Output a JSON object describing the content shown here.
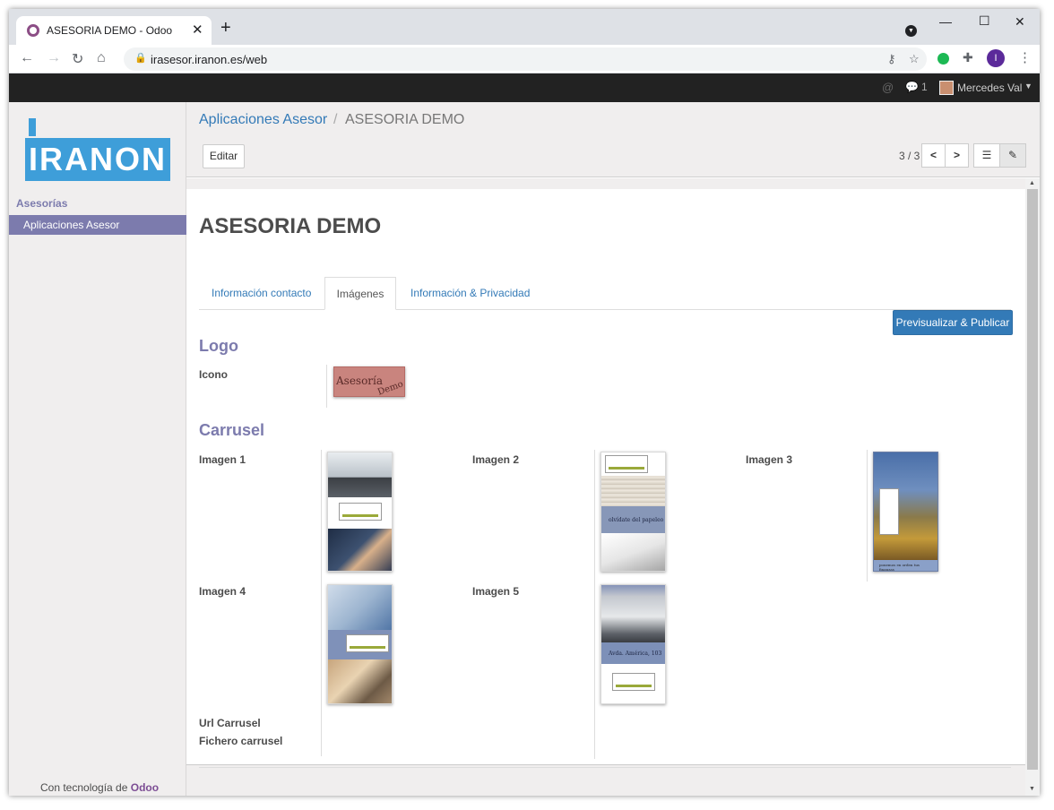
{
  "browser": {
    "tab_title": "ASESORIA DEMO - Odoo",
    "tab_close": "✕",
    "new_tab": "+",
    "url": "irasesor.iranon.es/web",
    "window_minimize": "—",
    "window_maximize": "☐",
    "window_close": "✕",
    "profile_initial": "I"
  },
  "topbar": {
    "chat_count": "1",
    "user_name": "Mercedes Val"
  },
  "sidebar": {
    "logo_text": "IRANON",
    "section_title": "Asesorías",
    "items": [
      {
        "label": "Aplicaciones Asesor"
      }
    ],
    "powered_prefix": "Con tecnología de ",
    "powered_brand": "Odoo"
  },
  "control_panel": {
    "breadcrumb_link": "Aplicaciones Asesor",
    "breadcrumb_sep": "/",
    "breadcrumb_current": "ASESORIA DEMO",
    "edit_label": "Editar",
    "pager": "3 / 3",
    "prev": "<",
    "next": ">"
  },
  "form": {
    "title": "ASESORIA DEMO",
    "tabs": [
      {
        "label": "Información contacto"
      },
      {
        "label": "Imágenes"
      },
      {
        "label": "Información & Privacidad"
      }
    ],
    "active_tab": 1,
    "publish_label": "Previsualizar & Publicar",
    "logo_section": "Logo",
    "icon_label": "Icono",
    "icon_image_text": [
      "Asesoría",
      "Demo"
    ],
    "carrusel_section": "Carrusel",
    "images": [
      {
        "label": "Imagen 1"
      },
      {
        "label": "Imagen 2",
        "caption": "olvídate del papeleo"
      },
      {
        "label": "Imagen 3",
        "caption": "ponemos en orden tus finanzas"
      },
      {
        "label": "Imagen 4"
      },
      {
        "label": "Imagen 5",
        "caption": "Avda. América, 103"
      }
    ],
    "url_carrusel_label": "Url Carrusel",
    "fichero_label": "Fichero carrusel"
  },
  "colors": {
    "primary": "#337ab7",
    "odoo_purple": "#7c7bad",
    "topbar": "#222222",
    "logo_blue": "#3e9ed9"
  }
}
